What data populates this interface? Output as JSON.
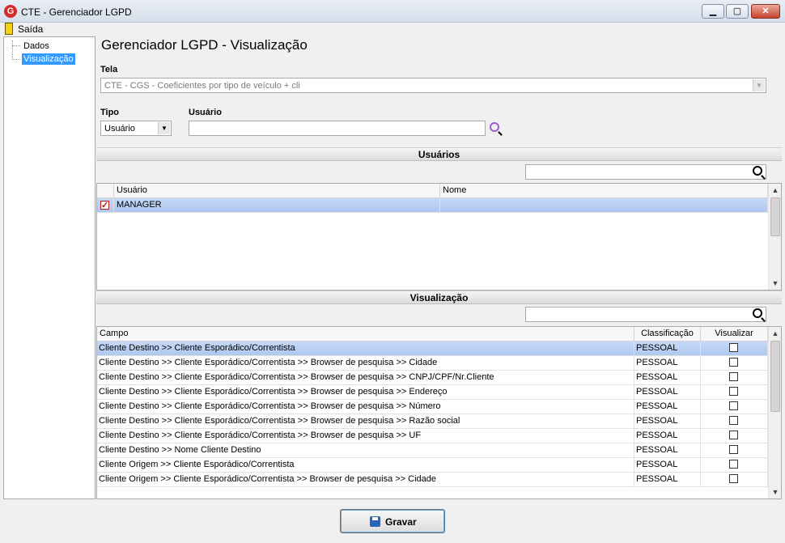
{
  "window": {
    "title": "CTE - Gerenciador LGPD",
    "app_icon": "G",
    "minimize_glyph": "▁",
    "maximize_glyph": "▢",
    "close_glyph": "✕"
  },
  "menubar": {
    "items": [
      {
        "label": "Saída",
        "icon": "exit-door-icon"
      }
    ]
  },
  "tree": {
    "items": [
      {
        "label": "Dados",
        "selected": false
      },
      {
        "label": "Visualização",
        "selected": true
      }
    ]
  },
  "page_title": "Gerenciador LGPD - Visualização",
  "tela": {
    "label": "Tela",
    "value": "CTE - CGS - Coeficientes por tipo de veículo + cli",
    "dropdown_arrow": "▼"
  },
  "tipo": {
    "label": "Tipo",
    "value": "Usuário",
    "dropdown_arrow": "▼"
  },
  "usuario": {
    "label": "Usuário",
    "value": ""
  },
  "usuarios_section": {
    "title": "Usuários",
    "filter_value": "",
    "columns": [
      "Usuário",
      "Nome"
    ],
    "rows": [
      {
        "checked": true,
        "usuario": "MANAGER",
        "nome": ""
      }
    ]
  },
  "visualizacao_section": {
    "title": "Visualização",
    "filter_value": "",
    "columns": [
      "Campo",
      "Classificação",
      "Visualizar"
    ],
    "rows": [
      {
        "campo": "Cliente Destino >> Cliente Esporádico/Correntista",
        "classificacao": "PESSOAL",
        "visualizar": false
      },
      {
        "campo": "Cliente Destino >> Cliente Esporádico/Correntista >> Browser de pesquisa >> Cidade",
        "classificacao": "PESSOAL",
        "visualizar": false
      },
      {
        "campo": "Cliente Destino >> Cliente Esporádico/Correntista >> Browser de pesquisa >> CNPJ/CPF/Nr.Cliente",
        "classificacao": "PESSOAL",
        "visualizar": false
      },
      {
        "campo": "Cliente Destino >> Cliente Esporádico/Correntista >> Browser de pesquisa >> Endereço",
        "classificacao": "PESSOAL",
        "visualizar": false
      },
      {
        "campo": "Cliente Destino >> Cliente Esporádico/Correntista >> Browser de pesquisa >> Número",
        "classificacao": "PESSOAL",
        "visualizar": false
      },
      {
        "campo": "Cliente Destino >> Cliente Esporádico/Correntista >> Browser de pesquisa >> Razão social",
        "classificacao": "PESSOAL",
        "visualizar": false
      },
      {
        "campo": "Cliente Destino >> Cliente Esporádico/Correntista >> Browser de pesquisa >> UF",
        "classificacao": "PESSOAL",
        "visualizar": false
      },
      {
        "campo": "Cliente Destino >> Nome Cliente Destino",
        "classificacao": "PESSOAL",
        "visualizar": false
      },
      {
        "campo": "Cliente Origem >> Cliente Esporádico/Correntista",
        "classificacao": "PESSOAL",
        "visualizar": false
      },
      {
        "campo": "Cliente Origem >> Cliente Esporádico/Correntista >> Browser de pesquisa >> Cidade",
        "classificacao": "PESSOAL",
        "visualizar": false
      }
    ]
  },
  "scroll_arrows": {
    "up": "▲",
    "down": "▼"
  },
  "save_button": {
    "label": "Gravar",
    "icon": "floppy-disk-icon"
  },
  "colors": {
    "selection": "#3399ff",
    "row_highlight": "#b6cdf2",
    "accent_red": "#c01818"
  }
}
